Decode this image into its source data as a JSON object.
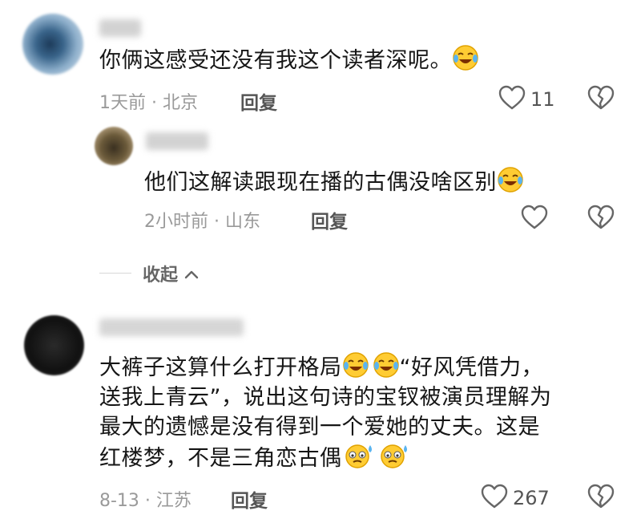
{
  "comments": [
    {
      "text": "你俩这感受还没有我这个读者深呢。",
      "meta": "1天前 · 北京",
      "reply_label": "回复",
      "like_count": "11",
      "emojis": [
        "laugh-cry-emoji"
      ]
    },
    {
      "text": "他们这解读跟现在播的古偶没啥区别",
      "meta": "2小时前 · 山东",
      "reply_label": "回复",
      "like_count": "",
      "emojis": [
        "laugh-cry-emoji"
      ]
    },
    {
      "lines": [
        "大裤子这算什么打开格局",
        "“好风凭借力，",
        "送我上青云”，说出这句诗的宝钗被演员理解为",
        "最大的遗憾是没有得到一个爱她的丈夫。这是",
        "红楼梦，不是三角恋古偶"
      ],
      "meta": "8-13 · 江苏",
      "reply_label": "回复",
      "like_count": "267",
      "emojis": [
        "laugh-cry-emoji",
        "laugh-cry-emoji",
        "sweat-smile-emoji",
        "sweat-smile-emoji"
      ]
    }
  ],
  "collapse_label": "收起",
  "colors": {
    "emoji_yellow": "#ffcc33",
    "emoji_face": "#f5a623",
    "icon_gray": "#666666"
  }
}
